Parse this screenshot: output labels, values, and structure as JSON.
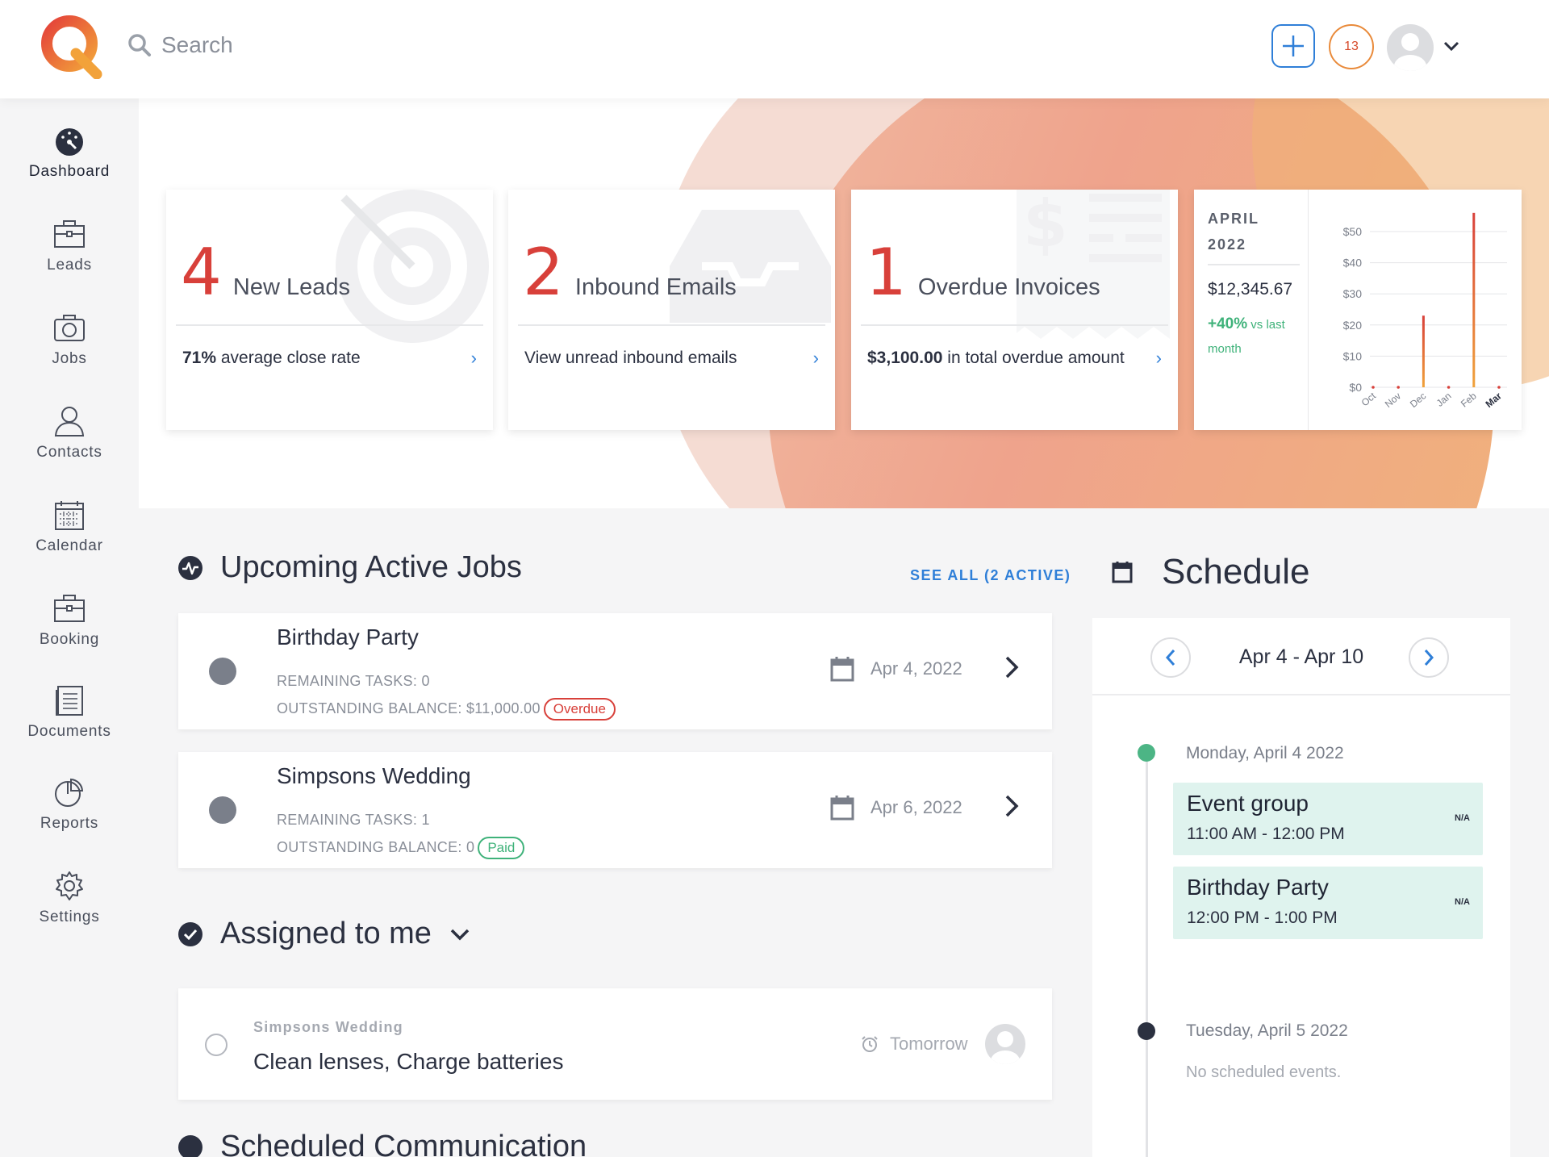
{
  "header": {
    "search_placeholder": "Search",
    "notification_count": "13"
  },
  "sidebar": {
    "items": [
      {
        "label": "Dashboard",
        "icon": "dashboard-gauge-icon"
      },
      {
        "label": "Leads",
        "icon": "briefcase-icon"
      },
      {
        "label": "Jobs",
        "icon": "camera-icon"
      },
      {
        "label": "Contacts",
        "icon": "person-icon"
      },
      {
        "label": "Calendar",
        "icon": "calendar-icon"
      },
      {
        "label": "Booking",
        "icon": "briefcase-icon"
      },
      {
        "label": "Documents",
        "icon": "document-icon"
      },
      {
        "label": "Reports",
        "icon": "pie-chart-icon"
      },
      {
        "label": "Settings",
        "icon": "gear-icon"
      }
    ]
  },
  "summary_cards": [
    {
      "number": "4",
      "label": "New Leads",
      "foot_bold": "71%",
      "foot_text": " average close rate"
    },
    {
      "number": "2",
      "label": "Inbound Emails",
      "foot_bold": "",
      "foot_text": "View unread inbound emails"
    },
    {
      "number": "1",
      "label": "Overdue Invoices",
      "foot_bold": "$3,100.00",
      "foot_text": " in total overdue amount"
    }
  ],
  "revenue": {
    "month": "APRIL",
    "year": "2022",
    "amount": "$12,345.67",
    "change": "+40%",
    "change_text": " vs last month"
  },
  "chart_data": {
    "type": "bar",
    "categories": [
      "Oct",
      "Nov",
      "Dec",
      "Jan",
      "Feb",
      "Mar"
    ],
    "values": [
      0,
      0,
      23,
      0,
      56,
      0
    ],
    "y_ticks": [
      "$0",
      "$10",
      "$20",
      "$30",
      "$40",
      "$50"
    ],
    "ylim": [
      0,
      55
    ],
    "highlighted_category": "Mar",
    "colors": {
      "bar_top": "#d8403a",
      "bar_bottom": "#f0a23a"
    }
  },
  "active_jobs": {
    "title": "Upcoming Active Jobs",
    "see_all": "SEE ALL (2 ACTIVE)",
    "items": [
      {
        "title": "Birthday Party",
        "remaining": "REMAINING TASKS: 0",
        "balance": "OUTSTANDING BALANCE: $11,000.00",
        "status": "Overdue",
        "date": "Apr 4, 2022"
      },
      {
        "title": "Simpsons Wedding",
        "remaining": "REMAINING TASKS: 1",
        "balance": "OUTSTANDING BALANCE: 0",
        "status": "Paid",
        "date": "Apr 6, 2022"
      }
    ]
  },
  "assigned": {
    "title": "Assigned to me",
    "items": [
      {
        "job": "Simpsons Wedding",
        "task": "Clean lenses, Charge batteries",
        "due": "Tomorrow"
      }
    ]
  },
  "scheduled_comm": {
    "title": "Scheduled Communication"
  },
  "schedule": {
    "title": "Schedule",
    "range": "Apr 4 - Apr 10",
    "days": [
      {
        "label": "Monday, April 4 2022",
        "events": [
          {
            "title": "Event group",
            "time": "11:00 AM - 12:00 PM",
            "tag": "N/A"
          },
          {
            "title": "Birthday Party",
            "time": "12:00 PM - 1:00 PM",
            "tag": "N/A"
          }
        ]
      },
      {
        "label": "Tuesday, April 5 2022",
        "empty": "No scheduled events."
      }
    ]
  },
  "colors": {
    "accent_blue": "#2f7fd8",
    "stat_red": "#d8403a",
    "positive_green": "#3fb27a",
    "event_bg": "#dff3ee"
  }
}
